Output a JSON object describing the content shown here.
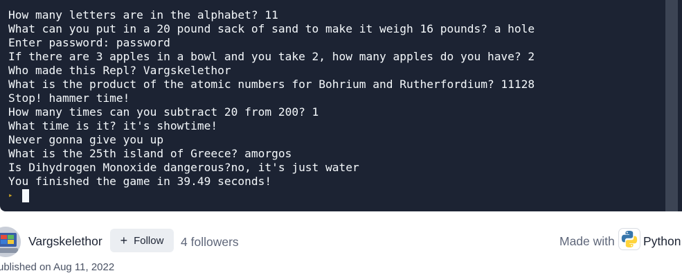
{
  "console": {
    "lines": [
      "How many letters are in the alphabet? 11",
      "What can you put in a 20 pound sack of sand to make it weigh 16 pounds? a hole",
      "Enter password: password",
      "If there are 3 apples in a bowl and you take 2, how many apples do you have? 2",
      "Who made this Repl? Vargskelethor",
      "What is the product of the atomic numbers for Bohrium and Rutherfordium? 11128",
      "Stop! hammer time!",
      "How many times can you subtract 20 from 200? 1",
      "What time is it? it's showtime!",
      "Never gonna give you up",
      "What is the 25th island of Greece? amorgos",
      "Is Dihydrogen Monoxide dangerous?no, it's just water",
      "You finished the game in 39.49 seconds!"
    ],
    "prompt_icon": "chevron-right-icon",
    "background": "#1c2333",
    "prompt_color": "#c9a227"
  },
  "author": {
    "name": "Vargskelethor",
    "follow_label": "Follow",
    "follow_icon": "plus-icon",
    "followers": "4 followers",
    "avatar_icon": "avatar-image"
  },
  "made_with": {
    "label": "Made with",
    "language": "Python",
    "language_icon": "python-logo-icon"
  },
  "published": "ublished on Aug 11, 2022"
}
